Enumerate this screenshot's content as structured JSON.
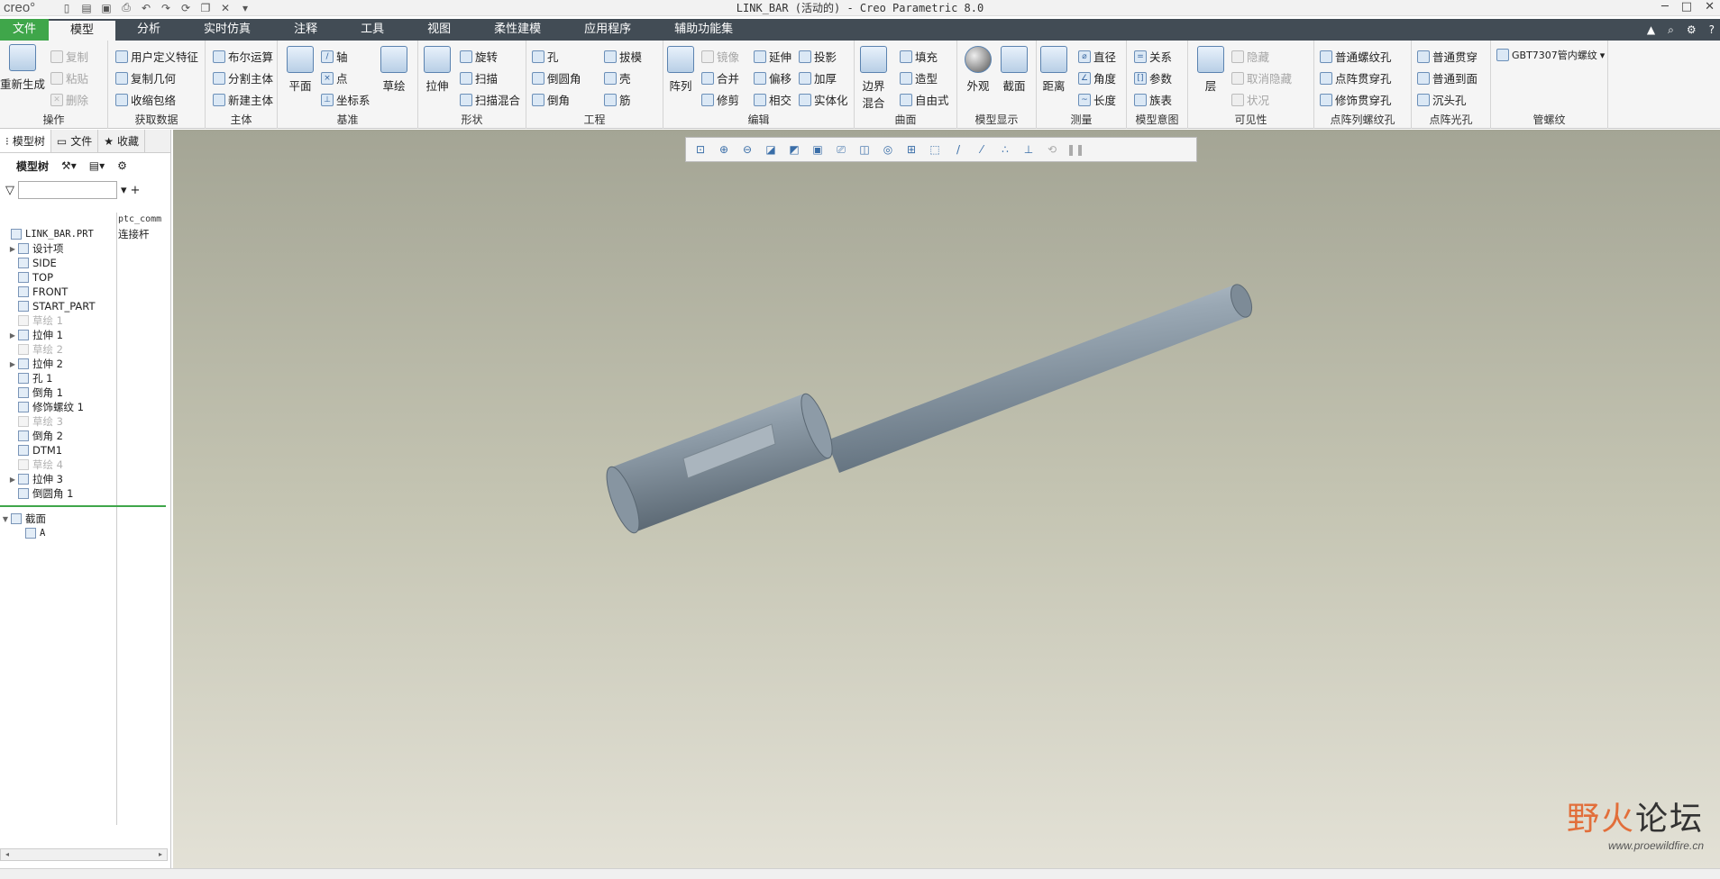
{
  "app": {
    "logo": "creo°",
    "window_title": "LINK_BAR (活动的) - Creo Parametric 8.0"
  },
  "quick_access": [
    "new-icon",
    "open-icon",
    "save-icon",
    "print-icon",
    "undo-icon",
    "redo-icon",
    "regenerate-icon",
    "windows-icon",
    "close-icon",
    "customize-icon"
  ],
  "menu": {
    "tabs": [
      "文件",
      "模型",
      "分析",
      "实时仿真",
      "注释",
      "工具",
      "视图",
      "柔性建模",
      "应用程序",
      "辅助功能集"
    ],
    "active": "模型"
  },
  "ribbon": {
    "ops": {
      "label": "操作",
      "regen": "重新生成",
      "copy": "复制",
      "paste": "粘贴",
      "delete": "删除"
    },
    "get_data": {
      "label": "获取数据",
      "udf": "用户定义特征",
      "copy_geom": "复制几何",
      "shrinkwrap": "收缩包络"
    },
    "body": {
      "label": "主体",
      "boolean": "布尔运算",
      "split": "分割主体",
      "new": "新建主体"
    },
    "datum": {
      "label": "基准",
      "plane": "平面",
      "axis": "轴",
      "point": "点",
      "csys": "坐标系",
      "sketch": "草绘"
    },
    "shapes": {
      "label": "形状",
      "extrude": "拉伸",
      "revolve": "旋转",
      "sweep": "扫描",
      "swept_blend": "扫描混合"
    },
    "eng": {
      "label": "工程",
      "hole": "孔",
      "round": "倒圆角",
      "chamfer": "倒角",
      "draft": "拔模",
      "shell": "壳",
      "rib": "筋"
    },
    "edit": {
      "label": "编辑",
      "pattern": "阵列",
      "mirror": "镜像",
      "merge": "合并",
      "trim": "修剪",
      "extend": "延伸",
      "offset": "偏移",
      "intersect": "相交",
      "project": "投影",
      "thicken": "加厚",
      "solidify": "实体化"
    },
    "surfaces": {
      "label": "曲面",
      "boundary": "边界\n混合",
      "fill": "填充",
      "style": "造型",
      "freestyle": "自由式"
    },
    "display": {
      "label": "模型显示",
      "appearance": "外观",
      "section": "截面"
    },
    "measure": {
      "label": "测量",
      "distance": "距离",
      "diameter": "直径",
      "angle": "角度",
      "length": "长度"
    },
    "intent": {
      "label": "模型意图",
      "relations": "关系",
      "params": "参数",
      "family": "族表"
    },
    "visibility": {
      "label": "可见性",
      "layer": "层",
      "hide": "隐藏",
      "unhide": "取消隐藏",
      "status": "状况"
    },
    "thread": {
      "label": "点阵列螺纹孔",
      "normal": "普通螺纹孔",
      "array_through": "点阵贯穿孔",
      "cosmetic_through": "修饰贯穿孔"
    },
    "array_hole": {
      "label": "点阵光孔",
      "normal_through": "普通贯穿",
      "normal_to_face": "普通到面",
      "counterbore": "沉头孔"
    },
    "pipe": {
      "label": "管螺纹",
      "gbt": "GBT7307管内螺纹"
    }
  },
  "left_panel": {
    "tabs": [
      "模型树",
      "文件",
      "收藏"
    ],
    "tool_label": "模型树",
    "search_placeholder": "",
    "column_header": "ptc_comm",
    "root": "LINK_BAR.PRT",
    "root_value": "连接杆",
    "items": [
      {
        "label": "设计项",
        "expand": true
      },
      {
        "label": "SIDE"
      },
      {
        "label": "TOP"
      },
      {
        "label": "FRONT"
      },
      {
        "label": "START_PART"
      },
      {
        "label": "草绘 1",
        "dim": true
      },
      {
        "label": "拉伸 1",
        "expand": true
      },
      {
        "label": "草绘 2",
        "dim": true
      },
      {
        "label": "拉伸 2",
        "expand": true
      },
      {
        "label": "孔 1"
      },
      {
        "label": "倒角 1"
      },
      {
        "label": "修饰螺纹 1"
      },
      {
        "label": "草绘 3",
        "dim": true
      },
      {
        "label": "倒角 2"
      },
      {
        "label": "DTM1"
      },
      {
        "label": "草绘 4",
        "dim": true
      },
      {
        "label": "拉伸 3",
        "expand": true
      },
      {
        "label": "倒圆角 1"
      }
    ],
    "sections_root": "截面",
    "section_item": "A"
  },
  "view_toolbar": [
    "refit-icon",
    "zoom-in-icon",
    "zoom-out-icon",
    "repaint-icon",
    "display-style-icon",
    "saved-views-icon",
    "view-manager-icon",
    "perspective-icon",
    "spin-center-icon",
    "annotation-icon",
    "plane-display-icon",
    "axis-display-icon",
    "point-display-icon",
    "csys-display-icon",
    "spin-icon",
    "pause-icon",
    "record-icon"
  ],
  "watermark": {
    "main_a": "野火",
    "main_b": "论坛",
    "url": "www.proewildfire.cn"
  },
  "colors": {
    "menu_bg": "#424c55",
    "file_tab": "#3fa64a",
    "ribbon_bg": "#f5f5f5"
  }
}
